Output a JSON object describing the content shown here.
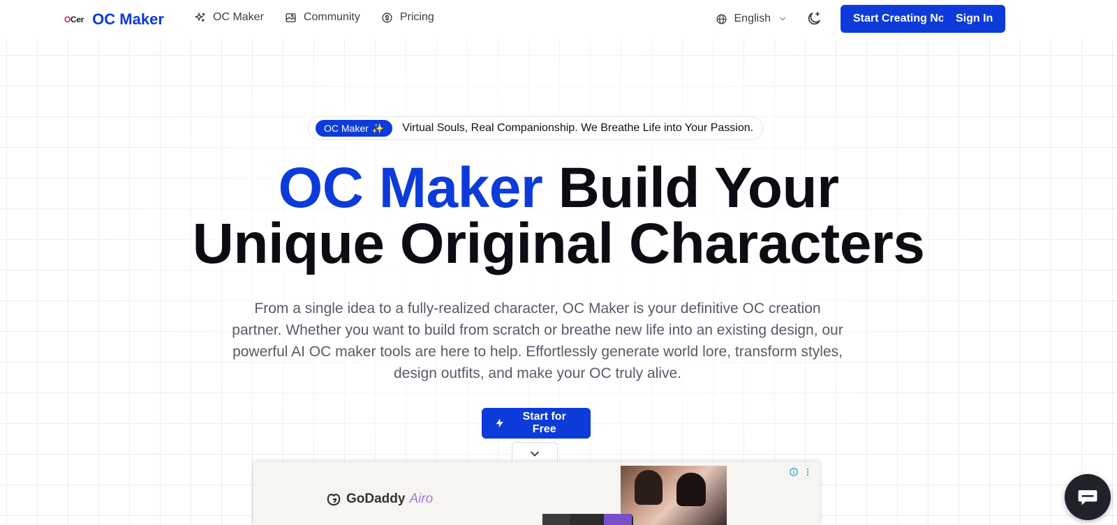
{
  "nav": {
    "logo_mark": "OCer",
    "logo_text": "OC Maker",
    "links": [
      {
        "label": "OC Maker",
        "icon": "sparkles-icon"
      },
      {
        "label": "Community",
        "icon": "gallery-icon"
      },
      {
        "label": "Pricing",
        "icon": "dollar-circle-icon"
      }
    ],
    "language": "English",
    "start_creating_label": "Start Creating Now",
    "sign_in_label": "Sign In"
  },
  "hero": {
    "pill_badge": "OC Maker",
    "pill_badge_emoji": "✨",
    "pill_text": "Virtual Souls, Real Companionship. We Breathe Life into Your Passion.",
    "headline_accent": "OC Maker",
    "headline_line1_rest": " Build Your",
    "headline_line2": "Unique Original Characters",
    "subtext": "From a single idea to a fully-realized character, OC Maker is your definitive OC creation partner. Whether you want to build from scratch or breathe new life into an existing design, our powerful AI OC maker tools are here to help. Effortlessly generate world lore, transform styles, design outfits, and make your OC truly alive.",
    "cta_label": "Start for Free"
  },
  "ad": {
    "brand": "GoDaddy",
    "brand_suffix": "Airo"
  },
  "colors": {
    "accent": "#0c3bd9",
    "text": "#0b0d12",
    "muted": "#555b66"
  }
}
